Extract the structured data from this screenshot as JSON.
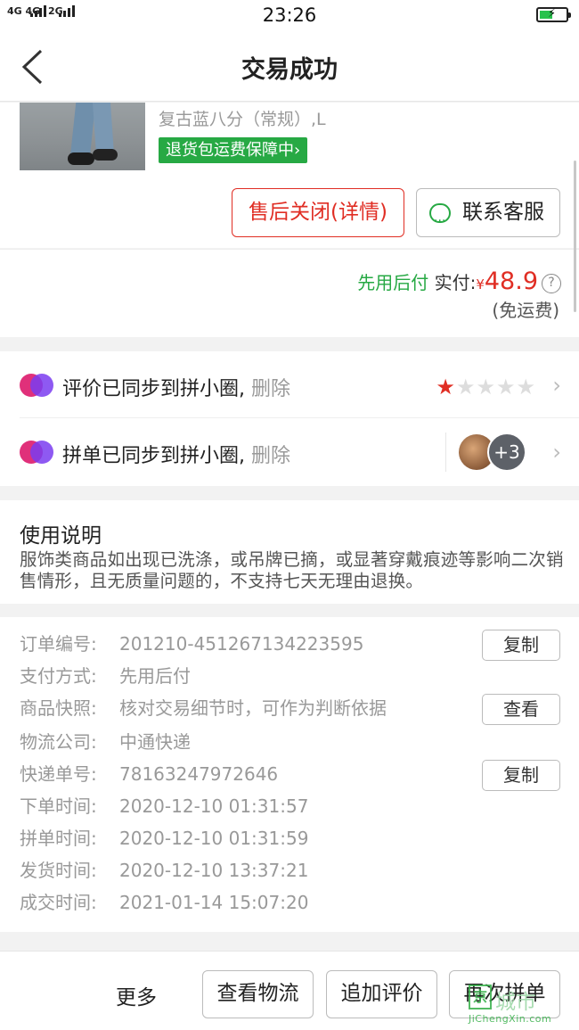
{
  "status_bar": {
    "signal_left": "4G 4G",
    "signal_right": "2G",
    "time": "23:26",
    "battery_icon": "battery-charging-icon"
  },
  "header": {
    "back_icon": "back-arrow-icon",
    "title": "交易成功"
  },
  "product": {
    "variant": "复古蓝八分（常规）,L",
    "return_shipping_badge": "退货包运费保障中",
    "badge_chevron": "›",
    "after_sale_button": "售后关闭(详情)",
    "contact_button": "联系客服"
  },
  "payment": {
    "method_label": "先用后付",
    "paid_label": "实付:",
    "currency": "¥",
    "amount": "48.9",
    "help": "?",
    "shipping_note": "(免运费)"
  },
  "sync": {
    "review": {
      "text": "评价已同步到拼小圈,",
      "delete": "删除",
      "stars_filled": 1,
      "stars_total": 5
    },
    "group": {
      "text": "拼单已同步到拼小圈,",
      "delete": "删除",
      "extra_count": "+3"
    },
    "chevron": "›"
  },
  "notice": {
    "title": "使用说明",
    "body": "服饰类商品如出现已洗涤，或吊牌已摘，或显著穿戴痕迹等影响二次销售情形，且无质量问题的，不支持七天无理由退换。"
  },
  "order": {
    "rows": [
      {
        "label": "订单编号:",
        "value": "201210-451267134223595",
        "button": "复制"
      },
      {
        "label": "支付方式:",
        "value": "先用后付"
      },
      {
        "label": "商品快照:",
        "value": "核对交易细节时，可作为判断依据",
        "button": "查看"
      },
      {
        "label": "物流公司:",
        "value": "中通快递"
      },
      {
        "label": "快递单号:",
        "value": "78163247972646",
        "button": "复制"
      },
      {
        "label": "下单时间:",
        "value": "2020-12-10 01:31:57"
      },
      {
        "label": "拼单时间:",
        "value": "2020-12-10 01:31:59"
      },
      {
        "label": "发货时间:",
        "value": "2020-12-10 13:37:21"
      },
      {
        "label": "成交时间:",
        "value": "2021-01-14 15:07:20"
      }
    ]
  },
  "bottom_bar": {
    "more": "更多",
    "buttons": [
      "查看物流",
      "追加评价",
      "再次拼单"
    ]
  },
  "watermark": {
    "name": "城市",
    "url": "JiChengXin.com"
  },
  "colors": {
    "accent_red": "#e02e24",
    "accent_green": "#27a944",
    "muted_text": "#999999"
  }
}
